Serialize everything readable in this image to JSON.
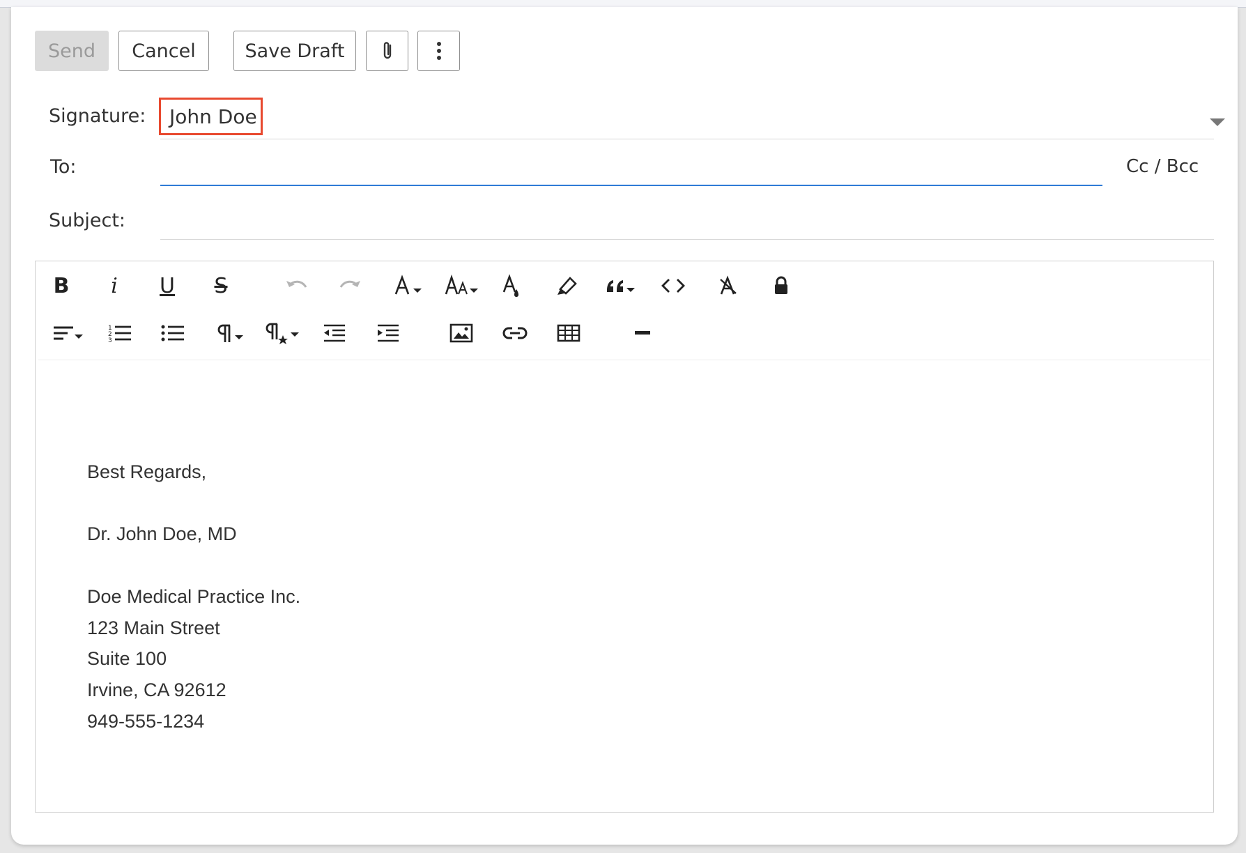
{
  "toolbar": {
    "send": "Send",
    "cancel": "Cancel",
    "save_draft": "Save Draft"
  },
  "fields": {
    "signature_label": "Signature:",
    "signature_value": "John Doe",
    "to_label": "To:",
    "cc_bcc": "Cc / Bcc",
    "subject_label": "Subject:"
  },
  "format": {
    "bold": "B",
    "italic": "i",
    "underline": "U",
    "strike": "S"
  },
  "body": {
    "lines": [
      "Best Regards,",
      "Dr. John Doe, MD",
      "Doe Medical Practice Inc.",
      "123 Main Street",
      "Suite 100",
      "Irvine, CA 92612",
      "949-555-1234"
    ]
  },
  "colors": {
    "accent": "#2f7bd6",
    "highlight_box": "#e8492f"
  }
}
